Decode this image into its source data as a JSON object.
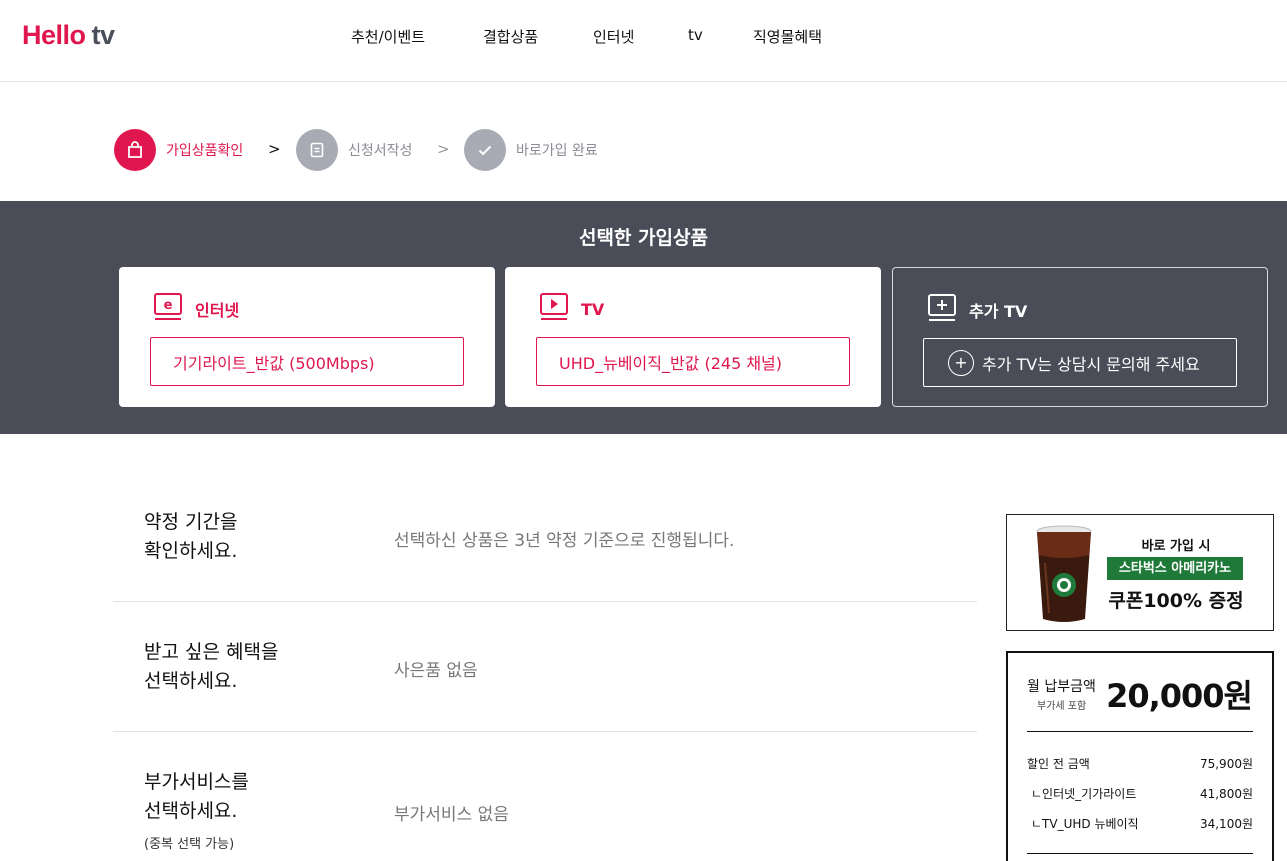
{
  "brand": {
    "hello": "Hello",
    "tv": "tv",
    "accent": "#e0174f"
  },
  "nav": [
    {
      "label": "추천/이벤트"
    },
    {
      "label": "결합상품"
    },
    {
      "label": "인터넷"
    },
    {
      "label": "tv"
    },
    {
      "label": "직영몰혜택"
    }
  ],
  "steps": [
    {
      "label": "가입상품확인",
      "icon": "shopping-bag-icon",
      "active": true
    },
    {
      "label": "신청서작성",
      "icon": "form-icon",
      "active": false
    },
    {
      "label": "바로가입 완료",
      "icon": "check-icon",
      "active": false
    }
  ],
  "step_arrow": ">",
  "selected": {
    "title": "선택한 가입상품",
    "cards": [
      {
        "label": "인터넷",
        "icon": "internet-e-icon",
        "value": "기기라이트_반값 (500Mbps)"
      },
      {
        "label": "TV",
        "icon": "tv-play-icon",
        "value": "UHD_뉴베이직_반값 (245 채널)"
      },
      {
        "label": "추가 TV",
        "icon": "tv-plus-icon",
        "value": "추가 TV는 상담시 문의해 주세요"
      }
    ]
  },
  "sections": [
    {
      "title_line1": "약정 기간을",
      "title_line2": "확인하세요.",
      "value": "선택하신 상품은 3년 약정 기준으로 진행됩니다."
    },
    {
      "title_line1": "받고 싶은 혜택을",
      "title_line2": "선택하세요.",
      "value": "사은품 없음"
    },
    {
      "title_line1": "부가서비스를",
      "title_line2": "선택하세요.",
      "note": "(중복 선택 가능)",
      "value": "부가서비스 없음"
    }
  ],
  "promo": {
    "line1": "바로 가입 시",
    "line2": "스타벅스 아메리카노",
    "line3": "쿠폰100% 증정",
    "badge_color": "#1f7a3a"
  },
  "price": {
    "label": "월 납부금액",
    "vat": "부가세 포함",
    "total": "20,000원",
    "items": [
      {
        "name": "할인 전 금액",
        "amount": "75,900원"
      },
      {
        "name": "ㄴ인터넷_기가라이트",
        "amount": "41,800원"
      },
      {
        "name": "ㄴTV_UHD 뉴베이직",
        "amount": "34,100원"
      }
    ]
  }
}
